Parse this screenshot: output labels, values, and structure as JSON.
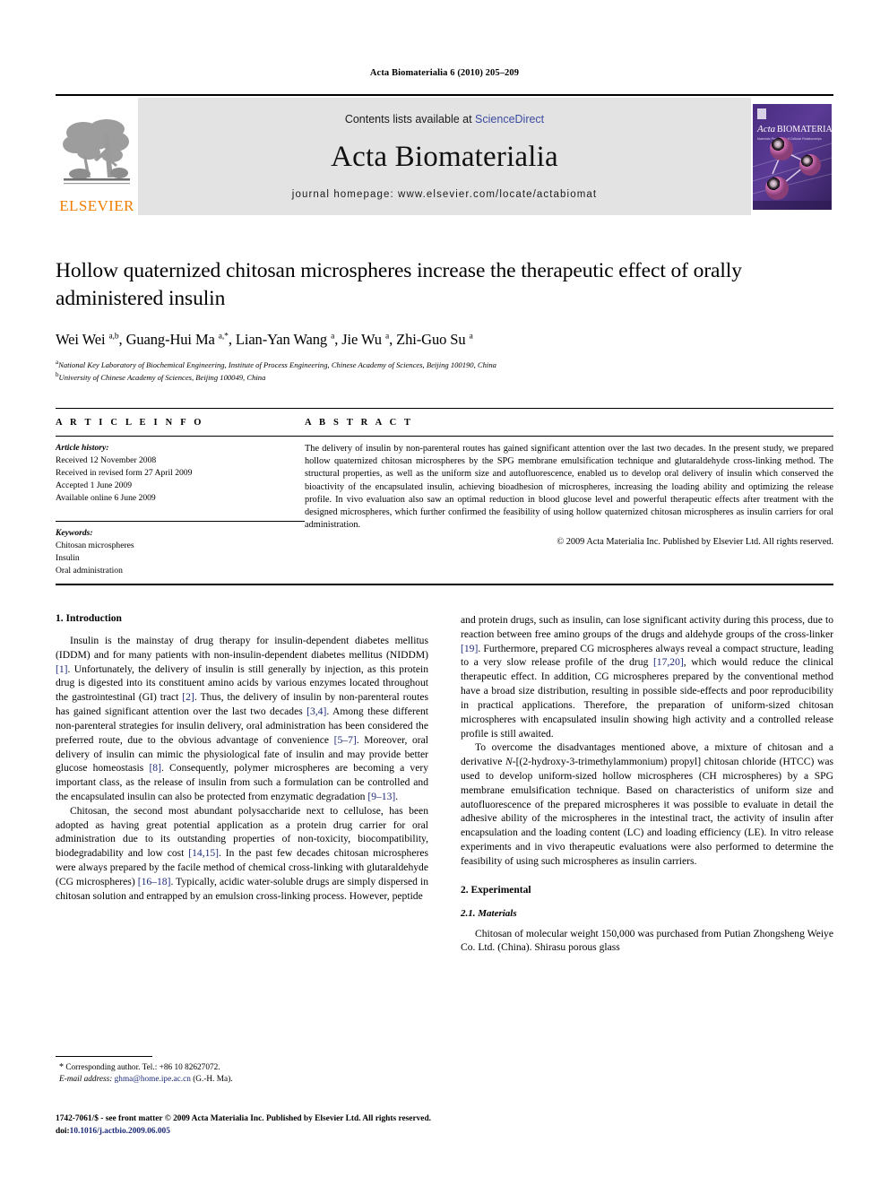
{
  "running_head": "Acta Biomaterialia 6 (2010) 205–209",
  "masthead": {
    "contents_prefix": "Contents lists available at ",
    "sciencedirect": "ScienceDirect",
    "journal_title": "Acta Biomaterialia",
    "homepage": "journal homepage: www.elsevier.com/locate/actabiomat",
    "publisher_wordmark": "ELSEVIER",
    "cover_title_italic": "Acta",
    "cover_title_caps": "BIOMATERIALIA",
    "cover_subtitle": "Materials Properties of Cellular Relationships in Biomaterials",
    "accent_color": "#f07d00",
    "link_color": "#3b4ba0"
  },
  "article": {
    "title": "Hollow quaternized chitosan microspheres increase the therapeutic effect of orally administered insulin",
    "authors_html": "Wei Wei <sup>a,b</sup>, Guang-Hui Ma <sup>a,*</sup>, Lian-Yan Wang <sup>a</sup>, Jie Wu <sup>a</sup>, Zhi-Guo Su <sup>a</sup>",
    "affiliation_a": "National Key Laboratory of Biochemical Engineering, Institute of Process Engineering, Chinese Academy of Sciences, Beijing 100190, China",
    "affiliation_b": "University of Chinese Academy of Sciences, Beijing 100049, China"
  },
  "article_info": {
    "heading": "A R T I C L E   I N F O",
    "history_label": "Article history:",
    "history": [
      "Received 12 November 2008",
      "Received in revised form 27 April 2009",
      "Accepted 1 June 2009",
      "Available online 6 June 2009"
    ],
    "keywords_label": "Keywords:",
    "keywords": [
      "Chitosan microspheres",
      "Insulin",
      "Oral administration"
    ]
  },
  "abstract": {
    "heading": "A B S T R A C T",
    "text": "The delivery of insulin by non-parenteral routes has gained significant attention over the last two decades. In the present study, we prepared hollow quaternized chitosan microspheres by the SPG membrane emulsification technique and glutaraldehyde cross-linking method. The structural properties, as well as the uniform size and autofluorescence, enabled us to develop oral delivery of insulin which conserved the bioactivity of the encapsulated insulin, achieving bioadhesion of microspheres, increasing the loading ability and optimizing the release profile. In vivo evaluation also saw an optimal reduction in blood glucose level and powerful therapeutic effects after treatment with the designed microspheres, which further confirmed the feasibility of using hollow quaternized chitosan microspheres as insulin carriers for oral administration.",
    "copyright": "© 2009 Acta Materialia Inc. Published by Elsevier Ltd. All rights reserved."
  },
  "body": {
    "intro_heading": "1. Introduction",
    "intro_p1_a": "Insulin is the mainstay of drug therapy for insulin-dependent diabetes mellitus (IDDM) and for many patients with non-insulin-dependent diabetes mellitus (NIDDM) ",
    "intro_p1_r1": "[1]",
    "intro_p1_b": ". Unfortunately, the delivery of insulin is still generally by injection, as this protein drug is digested into its constituent amino acids by various enzymes located throughout the gastrointestinal (GI) tract ",
    "intro_p1_r2": "[2]",
    "intro_p1_c": ". Thus, the delivery of insulin by non-parenteral routes has gained significant attention over the last two decades ",
    "intro_p1_r3": "[3,4]",
    "intro_p1_d": ". Among these different non-parenteral strategies for insulin delivery, oral administration has been considered the preferred route, due to the obvious advantage of convenience ",
    "intro_p1_r4": "[5–7]",
    "intro_p1_e": ". Moreover, oral delivery of insulin can mimic the physiological fate of insulin and may provide better glucose homeostasis ",
    "intro_p1_r5": "[8]",
    "intro_p1_f": ". Consequently, polymer microspheres are becoming a very important class, as the release of insulin from such a formulation can be controlled and the encapsulated insulin can also be protected from enzymatic degradation ",
    "intro_p1_r6": "[9–13]",
    "intro_p1_g": ".",
    "intro_p2_a": "Chitosan, the second most abundant polysaccharide next to cellulose, has been adopted as having great potential application as a protein drug carrier for oral administration due to its outstanding properties of non-toxicity, biocompatibility, biodegradability and low cost ",
    "intro_p2_r1": "[14,15]",
    "intro_p2_b": ". In the past few decades chitosan microspheres were always prepared by the facile method of chemical cross-linking with glutaraldehyde (CG microspheres) ",
    "intro_p2_r2": "[16–18]",
    "intro_p2_c": ". Typically, acidic water-soluble drugs are simply dispersed in chitosan solution and entrapped by an emulsion cross-linking process. However, peptide",
    "intro_p3_a": "and protein drugs, such as insulin, can lose significant activity during this process, due to reaction between free amino groups of the drugs and aldehyde groups of the cross-linker ",
    "intro_p3_r1": "[19]",
    "intro_p3_b": ". Furthermore, prepared CG microspheres always reveal a compact structure, leading to a very slow release profile of the drug ",
    "intro_p3_r2": "[17,20]",
    "intro_p3_c": ", which would reduce the clinical therapeutic effect. In addition, CG microspheres prepared by the conventional method have a broad size distribution, resulting in possible side-effects and poor reproducibility in practical applications. Therefore, the preparation of uniform-sized chitosan microspheres with encapsulated insulin showing high activity and a controlled release profile is still awaited.",
    "intro_p4_a": "To overcome the disadvantages mentioned above, a mixture of chitosan and a derivative ",
    "intro_p4_ital": "N",
    "intro_p4_b": "-[(2-hydroxy-3-trimethylammonium) propyl] chitosan chloride (HTCC) was used to develop uniform-sized hollow microspheres (CH microspheres) by a SPG membrane emulsification technique. Based on characteristics of uniform size and autofluorescence of the prepared microspheres it was possible to evaluate in detail the adhesive ability of the microspheres in the intestinal tract, the activity of insulin after encapsulation and the loading content (LC) and loading efficiency (LE). In vitro release experiments and in vivo therapeutic evaluations were also performed to determine the feasibility of using such microspheres as insulin carriers.",
    "exp_heading": "2. Experimental",
    "materials_heading": "2.1. Materials",
    "materials_p1": "Chitosan of molecular weight 150,000 was purchased from Putian Zhongsheng Weiye Co. Ltd. (China). Shirasu porous glass"
  },
  "footnote": {
    "star": "*",
    "corresponding": "Corresponding author. Tel.: +86 10 82627072.",
    "email_label": "E-mail address:",
    "email": "ghma@home.ipe.ac.cn",
    "email_owner": "(G.-H. Ma)."
  },
  "footer": {
    "issn_line": "1742-7061/$ - see front matter © 2009 Acta Materialia Inc. Published by Elsevier Ltd. All rights reserved.",
    "doi_prefix": "doi:",
    "doi": "10.1016/j.actbio.2009.06.005"
  }
}
